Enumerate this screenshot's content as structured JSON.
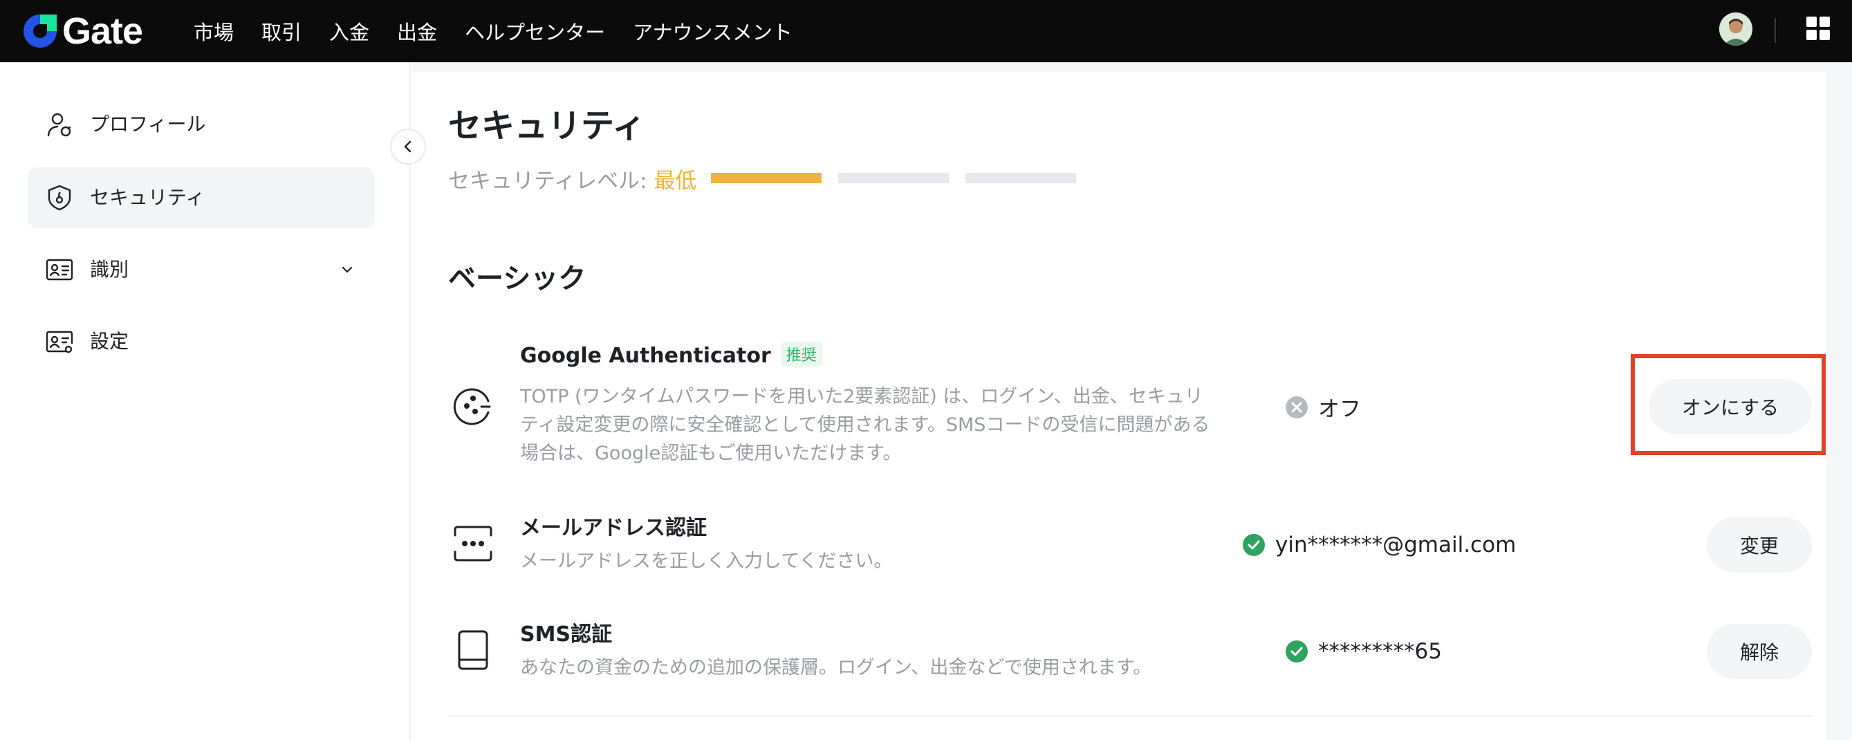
{
  "brand": {
    "name": "Gate"
  },
  "nav": [
    {
      "label": "市場"
    },
    {
      "label": "取引"
    },
    {
      "label": "入金"
    },
    {
      "label": "出金"
    },
    {
      "label": "ヘルプセンター"
    },
    {
      "label": "アナウンスメント"
    }
  ],
  "sidebar": {
    "items": [
      {
        "label": "プロフィール",
        "icon": "user-icon"
      },
      {
        "label": "セキュリティ",
        "icon": "shield-icon",
        "active": true
      },
      {
        "label": "識別",
        "icon": "id-card-icon",
        "expandable": true
      },
      {
        "label": "設定",
        "icon": "id-card-settings-icon"
      }
    ]
  },
  "page": {
    "title": "セキュリティ",
    "security_level_label": "セキュリティレベル: ",
    "security_level_value": "最低",
    "security_level_fraction": 0.33
  },
  "basic": {
    "title": "ベーシック",
    "rows": [
      {
        "title": "Google Authenticator",
        "badge": "推奨",
        "description": "TOTP (ワンタイムパスワードを用いた2要素認証) は、ログイン、出金、セキュリティ設定変更の際に安全確認として使用されます。SMSコードの受信に問題がある場合は、Google認証もご使用いただけます。",
        "status": "オフ",
        "status_state": "off",
        "action": "オンにする"
      },
      {
        "title": "メールアドレス認証",
        "description": "メールアドレスを正しく入力してください。",
        "status": "yin*******@gmail.com",
        "status_state": "on",
        "action": "変更"
      },
      {
        "title": "SMS認証",
        "description": "あなたの資金のための追加の保護層。ログイン、出金などで使用されます。",
        "status": "*********65",
        "status_state": "on",
        "action": "解除"
      }
    ]
  },
  "colors": {
    "topbar": "#0b0b0c",
    "brand_blue": "#2354e6",
    "brand_green": "#17e5a1",
    "level_accent": "#f0b43c",
    "status_on": "#2fa35f",
    "status_off": "#b7b9bf",
    "highlight": "#e2412b"
  }
}
